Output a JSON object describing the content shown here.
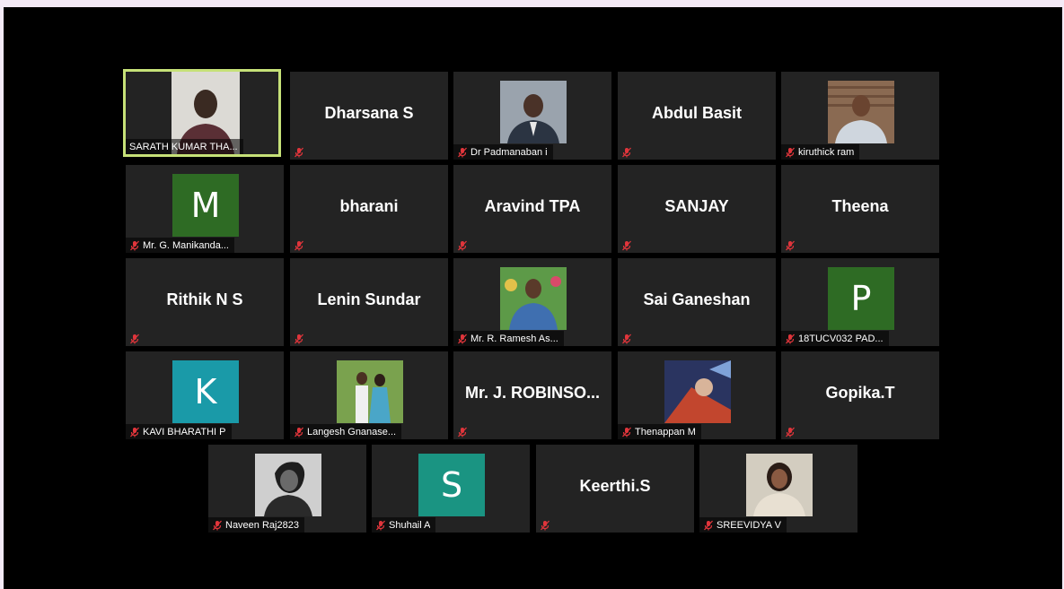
{
  "participants": [
    {
      "id": "sarath",
      "display": "photo",
      "label": "SARATH KUMAR THA...",
      "muted": false,
      "active": true,
      "photo_bg": "#d8d5cf",
      "icon": "person-photo"
    },
    {
      "id": "dharsana",
      "display": "name",
      "name": "Dharsana S",
      "muted": true
    },
    {
      "id": "padmanaban",
      "display": "photo",
      "label": "Dr Padmanaban i",
      "muted": true,
      "photo_bg": "#8c98a4",
      "icon": "person-photo"
    },
    {
      "id": "abdul",
      "display": "name",
      "name": "Abdul Basit",
      "muted": true
    },
    {
      "id": "kiruthick",
      "display": "photo",
      "label": "kiruthick ram",
      "muted": true,
      "photo_bg": "#7b5a44",
      "icon": "person-photo"
    },
    {
      "id": "manikandan",
      "display": "letter",
      "letter": "M",
      "letter_bg": "#2e6b24",
      "label": "Mr. G. Manikanda...",
      "muted": true
    },
    {
      "id": "bharani",
      "display": "name",
      "name": "bharani",
      "muted": true
    },
    {
      "id": "aravind",
      "display": "name",
      "name": "Aravind TPA",
      "muted": true
    },
    {
      "id": "sanjay",
      "display": "name",
      "name": "SANJAY",
      "muted": true
    },
    {
      "id": "theena",
      "display": "name",
      "name": "Theena",
      "muted": true
    },
    {
      "id": "rithik",
      "display": "name",
      "name": "Rithik N S",
      "muted": true
    },
    {
      "id": "lenin",
      "display": "name",
      "name": "Lenin Sundar",
      "muted": true
    },
    {
      "id": "ramesh",
      "display": "photo",
      "label": "Mr. R. Ramesh As...",
      "muted": true,
      "photo_bg": "#4c8a3a",
      "icon": "person-photo"
    },
    {
      "id": "sai",
      "display": "name",
      "name": "Sai Ganeshan",
      "muted": true
    },
    {
      "id": "pad",
      "display": "letter",
      "letter": "P",
      "letter_bg": "#2e6b24",
      "label": "18TUCV032 PAD...",
      "muted": true
    },
    {
      "id": "kavi",
      "display": "letter",
      "letter": "K",
      "letter_bg": "#1a9aa8",
      "label": "KAVI BHARATHI P",
      "muted": true
    },
    {
      "id": "langesh",
      "display": "photo",
      "label": "Langesh Gnanase...",
      "muted": true,
      "photo_bg": "#6f9a46",
      "icon": "person-photo"
    },
    {
      "id": "robinson",
      "display": "name",
      "name": "Mr. J. ROBINSO...",
      "muted": true
    },
    {
      "id": "thenappan",
      "display": "photo",
      "label": "Thenappan M",
      "muted": true,
      "photo_bg": "#3a4f86",
      "icon": "person-photo"
    },
    {
      "id": "gopika",
      "display": "name",
      "name": "Gopika.T",
      "muted": true
    },
    {
      "id": "naveen",
      "display": "photo",
      "label": "Naveen Raj2823",
      "muted": true,
      "photo_bg": "#b8b8b8",
      "icon": "person-photo"
    },
    {
      "id": "shuhail",
      "display": "letter",
      "letter": "S",
      "letter_bg": "#1a9482",
      "label": "Shuhail A",
      "muted": true
    },
    {
      "id": "keerthi",
      "display": "name",
      "name": "Keerthi.S",
      "muted": true
    },
    {
      "id": "sreevidya",
      "display": "photo",
      "label": "SREEVIDYA V",
      "muted": true,
      "photo_bg": "#c9c2b4",
      "icon": "person-photo"
    }
  ],
  "colors": {
    "mic_muted": "#e0353b",
    "active_border": "#c6e178",
    "tile_bg": "#232323"
  }
}
